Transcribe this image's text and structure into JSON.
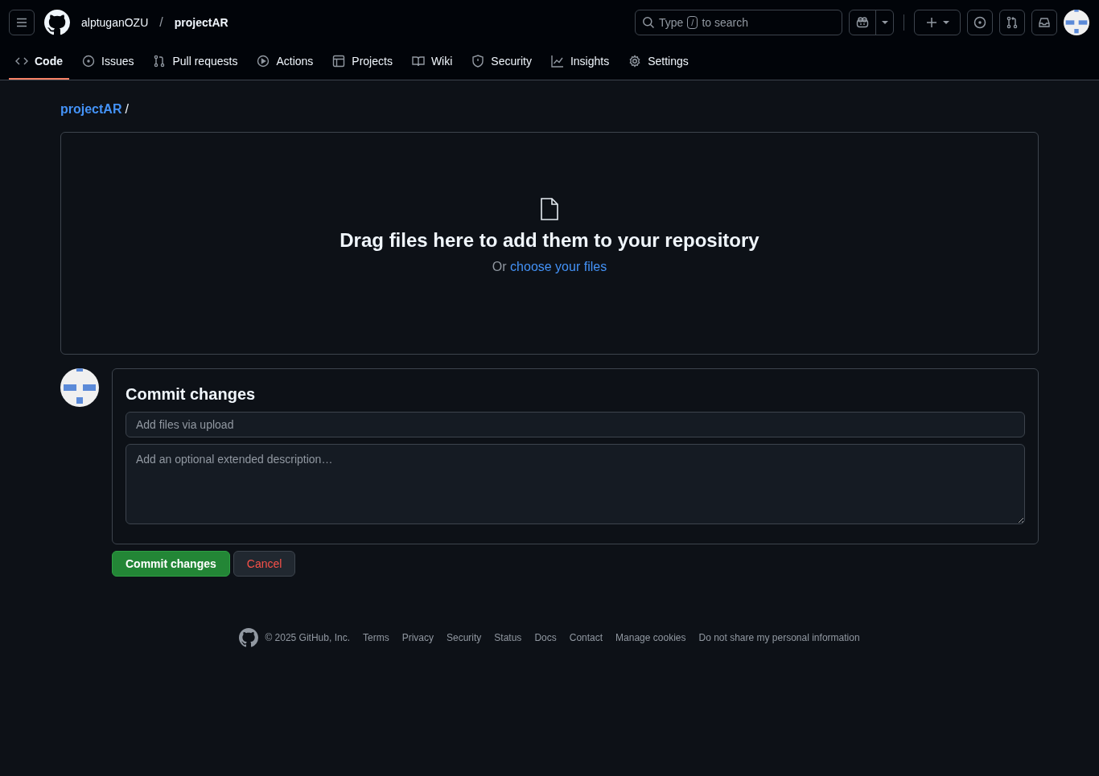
{
  "header": {
    "owner": "alptuganOZU",
    "separator": "/",
    "repo": "projectAR",
    "search": {
      "before": "Type",
      "key": "/",
      "after": "to search"
    }
  },
  "tabs": [
    {
      "label": "Code",
      "selected": true
    },
    {
      "label": "Issues",
      "selected": false
    },
    {
      "label": "Pull requests",
      "selected": false
    },
    {
      "label": "Actions",
      "selected": false
    },
    {
      "label": "Projects",
      "selected": false
    },
    {
      "label": "Wiki",
      "selected": false
    },
    {
      "label": "Security",
      "selected": false
    },
    {
      "label": "Insights",
      "selected": false
    },
    {
      "label": "Settings",
      "selected": false
    }
  ],
  "breadcrumb": {
    "repo": "projectAR",
    "separator": "/"
  },
  "dropzone": {
    "title": "Drag files here to add them to your repository",
    "prefix": "Or",
    "link": "choose your files"
  },
  "commit": {
    "title": "Commit changes",
    "summary_placeholder": "Add files via upload",
    "description_placeholder": "Add an optional extended description…",
    "submit": "Commit changes",
    "cancel": "Cancel"
  },
  "footer": {
    "copyright": "© 2025 GitHub, Inc.",
    "links": [
      "Terms",
      "Privacy",
      "Security",
      "Status",
      "Docs",
      "Contact",
      "Manage cookies",
      "Do not share my personal information"
    ]
  }
}
